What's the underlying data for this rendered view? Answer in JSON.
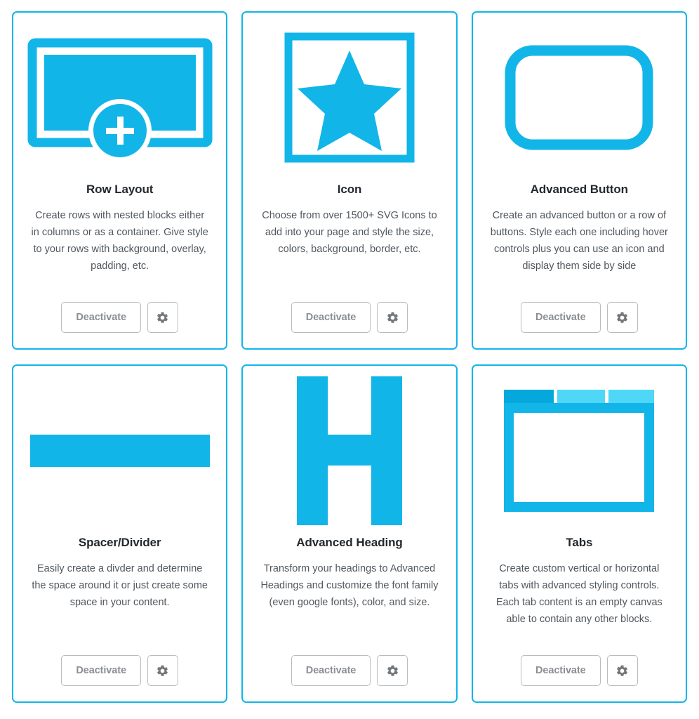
{
  "theme": {
    "accent": "#12b5e8",
    "accent_light": "#4fd7f7",
    "accent_dark": "#05a8dd",
    "title_color": "#23282d",
    "body_color": "#50575e",
    "button_border": "#b8bcbf",
    "button_text": "#8b8f94",
    "page_background": "#ffffff"
  },
  "blocks": [
    {
      "icon": "row-layout-icon",
      "title": "Row Layout",
      "description": "Create rows with nested blocks either in columns or as a container. Give style to your rows with background, overlay, padding, etc.",
      "deactivate_label": "Deactivate",
      "settings_icon": "gear-icon"
    },
    {
      "icon": "star-in-square-icon",
      "title": "Icon",
      "description": "Choose from over 1500+ SVG Icons to add into your page and style the size, colors, background, border, etc.",
      "deactivate_label": "Deactivate",
      "settings_icon": "gear-icon"
    },
    {
      "icon": "rounded-button-icon",
      "title": "Advanced Button",
      "description": "Create an advanced button or a row of buttons. Style each one including hover controls plus you can use an icon and display them side by side",
      "deactivate_label": "Deactivate",
      "settings_icon": "gear-icon"
    },
    {
      "icon": "divider-bar-icon",
      "title": "Spacer/Divider",
      "description": "Easily create a divder and determine the space around it or just create some space in your content.",
      "deactivate_label": "Deactivate",
      "settings_icon": "gear-icon"
    },
    {
      "icon": "letter-h-icon",
      "title": "Advanced Heading",
      "description": "Transform your headings to Advanced Headings and customize the font family (even google fonts), color, and size.",
      "deactivate_label": "Deactivate",
      "settings_icon": "gear-icon"
    },
    {
      "icon": "tabs-icon",
      "title": "Tabs",
      "description": "Create custom vertical or horizontal tabs with advanced styling controls. Each tab content is an empty canvas able to contain any other blocks.",
      "deactivate_label": "Deactivate",
      "settings_icon": "gear-icon"
    }
  ]
}
